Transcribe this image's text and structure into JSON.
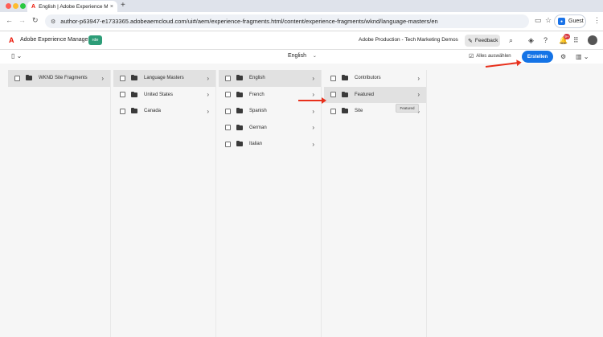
{
  "browser": {
    "traffic_colors": [
      "#ff5f57",
      "#febc2e",
      "#28c840"
    ],
    "tab_label": "English | Adobe Experience M",
    "tab_favicon": "A",
    "tab_close": "×",
    "new_tab": "+",
    "url": "author-p63947-e1733365.adobeaemcloud.com/ui#/aem/experience-fragments.html/content/experience-fragments/wknd/language-masters/en",
    "guest_label": "Guest",
    "icons": [
      "back-icon",
      "forward-icon",
      "reload-icon",
      "site-info-icon",
      "cast-icon",
      "bookmark-icon",
      "profile-icon",
      "menu-icon"
    ]
  },
  "aem_header": {
    "logo": "A",
    "title": "Adobe Experience Manager",
    "env_badge": "rde",
    "env_badge_color": "#2d9d78",
    "org_name": "Adobe Production - Tech Marketing Demos",
    "feedback_label": "Feedback",
    "notification_count": "9+",
    "icons": [
      "search-icon",
      "solutions-icon",
      "help-icon",
      "notifications-icon",
      "apps-icon",
      "user-avatar"
    ]
  },
  "action_bar": {
    "root_label": "English",
    "select_all_label": "Alles auswählen",
    "create_label": "Erstellen",
    "accent_color": "#1473e6",
    "icons": [
      "rail-toggle-icon",
      "settings-icon",
      "view-switch-icon"
    ]
  },
  "columns": [
    {
      "items": [
        {
          "label": "WKND Site Fragments",
          "active": true,
          "has_children": true
        }
      ]
    },
    {
      "items": [
        {
          "label": "Language Masters",
          "active": true,
          "has_children": true
        },
        {
          "label": "United States",
          "active": false,
          "has_children": true
        },
        {
          "label": "Canada",
          "active": false,
          "has_children": true
        }
      ]
    },
    {
      "items": [
        {
          "label": "English",
          "active": true,
          "has_children": true
        },
        {
          "label": "French",
          "active": false,
          "has_children": true
        },
        {
          "label": "Spanish",
          "active": false,
          "has_children": true
        },
        {
          "label": "German",
          "active": false,
          "has_children": true
        },
        {
          "label": "Italian",
          "active": false,
          "has_children": true
        }
      ]
    },
    {
      "items": [
        {
          "label": "Contributors",
          "active": false,
          "has_children": true
        },
        {
          "label": "Featured",
          "active": true,
          "has_children": true
        },
        {
          "label": "Site",
          "active": false,
          "has_children": true
        }
      ]
    }
  ],
  "tooltip": "Featured",
  "annotation_color": "#e8301c"
}
